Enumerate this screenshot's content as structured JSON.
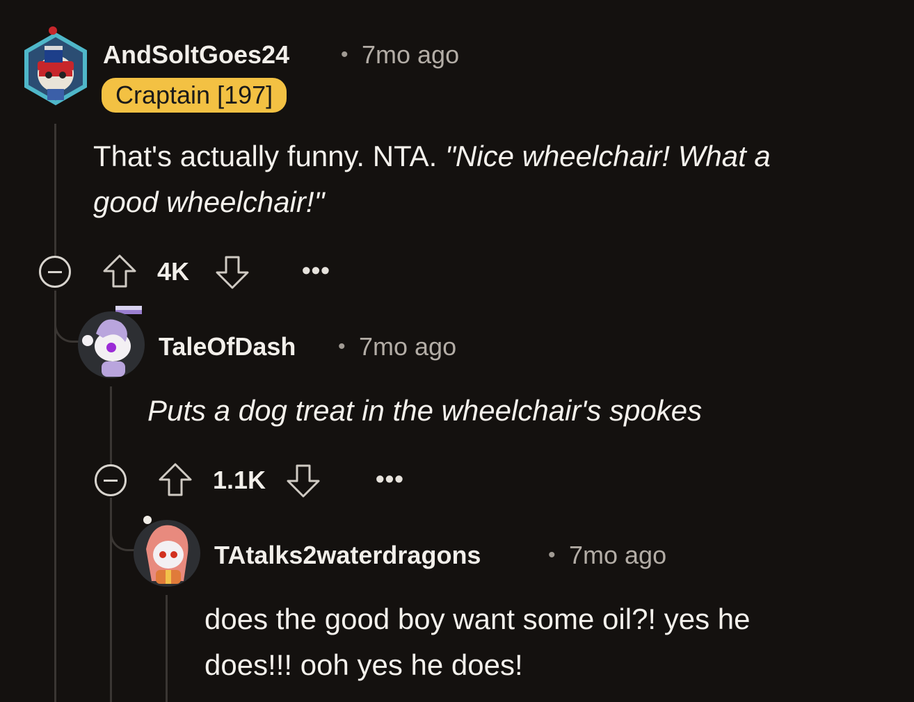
{
  "comments": [
    {
      "username": "AndSoltGoes24",
      "separator": "•",
      "time": "7mo ago",
      "flair": "Craptain [197]",
      "body_plain": "That's actually funny. NTA. ",
      "body_italic_1": "\"Nice wheelchair! What a",
      "body_italic_2": "good wheelchair!\"",
      "score": "4K",
      "more": "•••"
    },
    {
      "username": "TaleOfDash",
      "separator": "•",
      "time": "7mo ago",
      "body_italic": "Puts a dog treat in the wheelchair's spokes",
      "score": "1.1K",
      "more": "•••"
    },
    {
      "username": "TAtalks2waterdragons",
      "separator": "•",
      "time": "7mo ago",
      "body_line_1": "does the good boy want some oil?! yes he",
      "body_line_2": "does!!! ooh yes he does!"
    }
  ],
  "icons": {
    "collapse": "minus-circle-icon",
    "upvote": "arrow-up-icon",
    "downvote": "arrow-down-icon",
    "more": "ellipsis-icon"
  },
  "colors": {
    "background": "#14110f",
    "flair": "#f3c143",
    "thread_line": "#3a3633",
    "muted_text": "#b3ada6"
  }
}
